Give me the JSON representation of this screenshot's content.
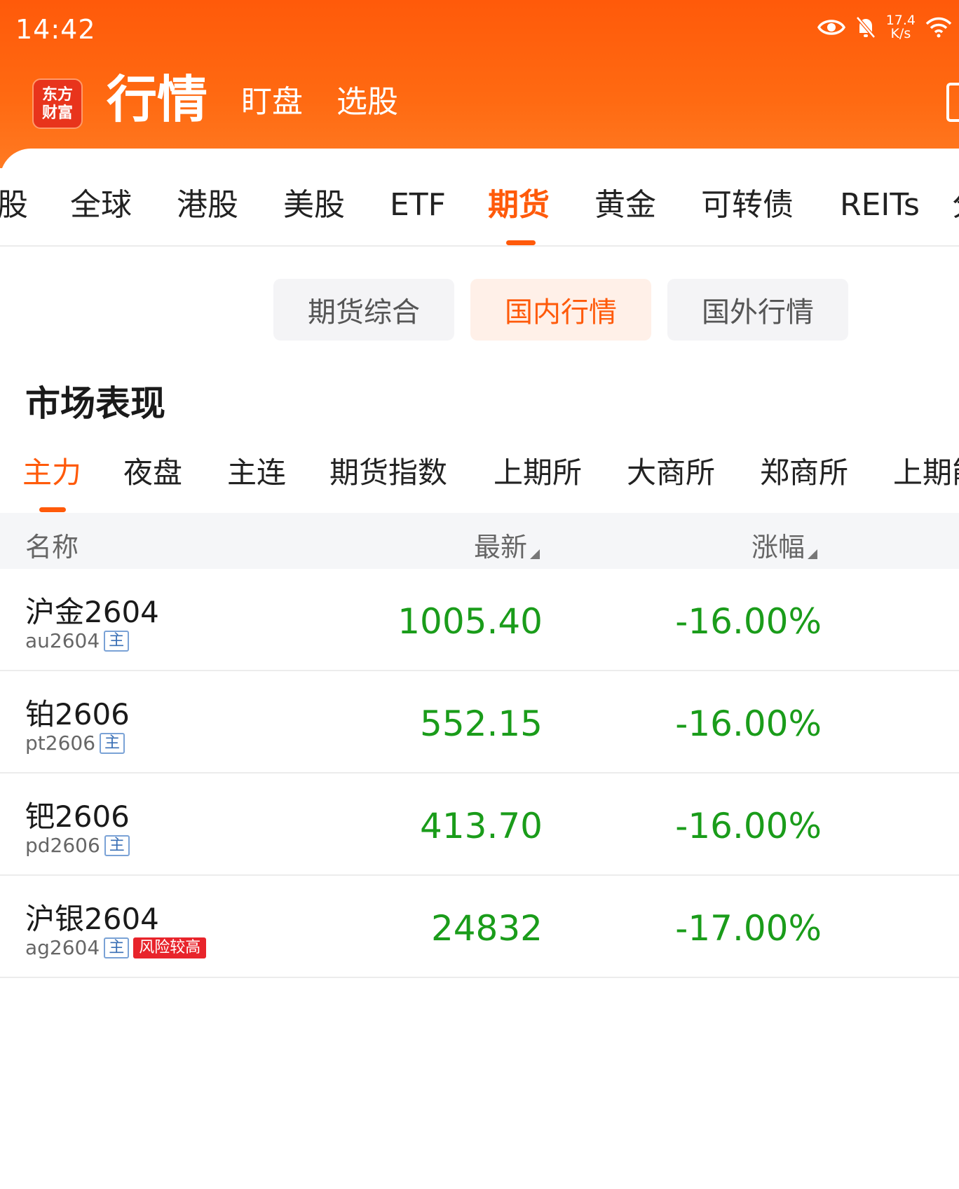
{
  "status_bar": {
    "time": "14:42",
    "net_speed_value": "17.4",
    "net_speed_unit": "K/s",
    "icons": [
      "eye-icon",
      "bell-off-icon",
      "wifi-icon"
    ]
  },
  "header": {
    "logo_line1": "东方",
    "logo_line2": "财富",
    "nav": [
      "行情",
      "盯盘",
      "选股"
    ],
    "active_nav": "行情"
  },
  "category_tabs": [
    "股",
    "全球",
    "港股",
    "美股",
    "ETF",
    "期货",
    "黄金",
    "可转债",
    "REITs",
    "分"
  ],
  "active_category": "期货",
  "segments": [
    "期货综合",
    "国内行情",
    "国外行情"
  ],
  "active_segment": "国内行情",
  "section_title": "市场表现",
  "sub_tabs": [
    "主力",
    "夜盘",
    "主连",
    "期货指数",
    "上期所",
    "大商所",
    "郑商所",
    "上期能"
  ],
  "active_sub_tab": "主力",
  "table": {
    "columns": [
      "名称",
      "最新",
      "涨幅"
    ],
    "rows": [
      {
        "name": "沪金2604",
        "code": "au2604",
        "tag": "主",
        "risk": "",
        "price": "1005.40",
        "change": "-16.00%"
      },
      {
        "name": "铂2606",
        "code": "pt2606",
        "tag": "主",
        "risk": "",
        "price": "552.15",
        "change": "-16.00%"
      },
      {
        "name": "钯2606",
        "code": "pd2606",
        "tag": "主",
        "risk": "",
        "price": "413.70",
        "change": "-16.00%"
      },
      {
        "name": "沪银2604",
        "code": "ag2604",
        "tag": "主",
        "risk": "风险较高",
        "price": "24832",
        "change": "-17.00%"
      }
    ]
  },
  "colors": {
    "brand": "#ff5a0a",
    "down": "#1a9c1a",
    "risk": "#e8242b"
  }
}
